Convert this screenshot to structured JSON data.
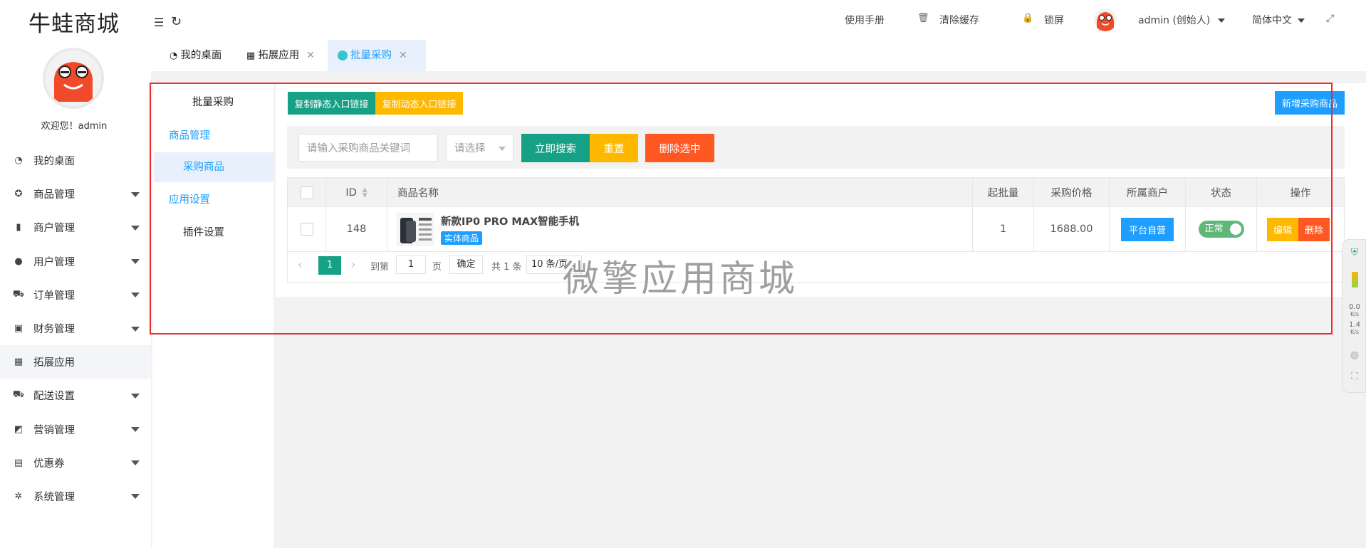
{
  "app": {
    "logo_text": "牛蛙商城",
    "welcome": "欢迎您！admin"
  },
  "sidebar": {
    "items": [
      {
        "label": "我的桌面",
        "icon": "dashboard-icon",
        "glyph": "◔",
        "has_submenu": false
      },
      {
        "label": "商品管理",
        "icon": "settings-icon",
        "glyph": "✪",
        "has_submenu": true
      },
      {
        "label": "商户管理",
        "icon": "building-icon",
        "glyph": "▮",
        "has_submenu": true
      },
      {
        "label": "用户管理",
        "icon": "user-icon",
        "glyph": "●",
        "has_submenu": true
      },
      {
        "label": "订单管理",
        "icon": "cart-icon",
        "glyph": "⛟",
        "has_submenu": true
      },
      {
        "label": "财务管理",
        "icon": "money-icon",
        "glyph": "▣",
        "has_submenu": true
      },
      {
        "label": "拓展应用",
        "icon": "apps-icon",
        "glyph": "▦",
        "has_submenu": false,
        "active": true
      },
      {
        "label": "配送设置",
        "icon": "truck-icon",
        "glyph": "⛟",
        "has_submenu": true
      },
      {
        "label": "营销管理",
        "icon": "chart-icon",
        "glyph": "◩",
        "has_submenu": true
      },
      {
        "label": "优惠券",
        "icon": "coupon-icon",
        "glyph": "▤",
        "has_submenu": true
      },
      {
        "label": "系统管理",
        "icon": "gear-icon",
        "glyph": "✲",
        "has_submenu": true
      }
    ]
  },
  "header": {
    "manual": "使用手册",
    "clear_cache": "清除缓存",
    "lock": "锁屏",
    "user": "admin (创始人)",
    "language": "简体中文"
  },
  "tabs": [
    {
      "label": "我的桌面",
      "closable": false
    },
    {
      "label": "拓展应用",
      "closable": true
    },
    {
      "label": "批量采购",
      "closable": true,
      "active": true
    }
  ],
  "subnav": {
    "title": "批量采购",
    "groups": [
      {
        "label": "商品管理",
        "items": [
          "采购商品"
        ]
      },
      {
        "label": "应用设置",
        "items": [
          "插件设置"
        ]
      }
    ],
    "selected": "采购商品"
  },
  "toolbar": {
    "copy_static": "复制静态入口链接",
    "copy_dynamic": "复制动态入口链接",
    "add_product": "新增采购商品"
  },
  "search": {
    "keyword_placeholder": "请输入采购商品关键词",
    "select_placeholder": "请选择",
    "search_button": "立即搜索",
    "reset_button": "重置",
    "delete_button": "删除选中"
  },
  "table": {
    "headers": [
      "ID",
      "商品名称",
      "起批量",
      "采购价格",
      "所属商户",
      "状态",
      "操作"
    ],
    "rows": [
      {
        "id": "148",
        "name": "新款IP0 PRO MAX智能手机",
        "tag": "实体商品",
        "min_batch": "1",
        "price": "1688.00",
        "merchant": "平台自营",
        "status": "正常",
        "edit": "编辑",
        "delete": "删除"
      }
    ]
  },
  "pagination": {
    "current": "1",
    "goto_label": "到第",
    "goto_value": "1",
    "page_label": "页",
    "confirm": "确定",
    "total": "共 1 条",
    "page_size": "10 条/页"
  },
  "watermark": "微擎应用商城",
  "floatbar": {
    "speed_1": "0.0",
    "speed_2": "1.4",
    "unit": "K/s"
  },
  "colors": {
    "primary": "#1e9fff",
    "teal": "#16a085",
    "warm": "#ffb800",
    "danger": "#ff5722",
    "success": "#5fb878"
  }
}
